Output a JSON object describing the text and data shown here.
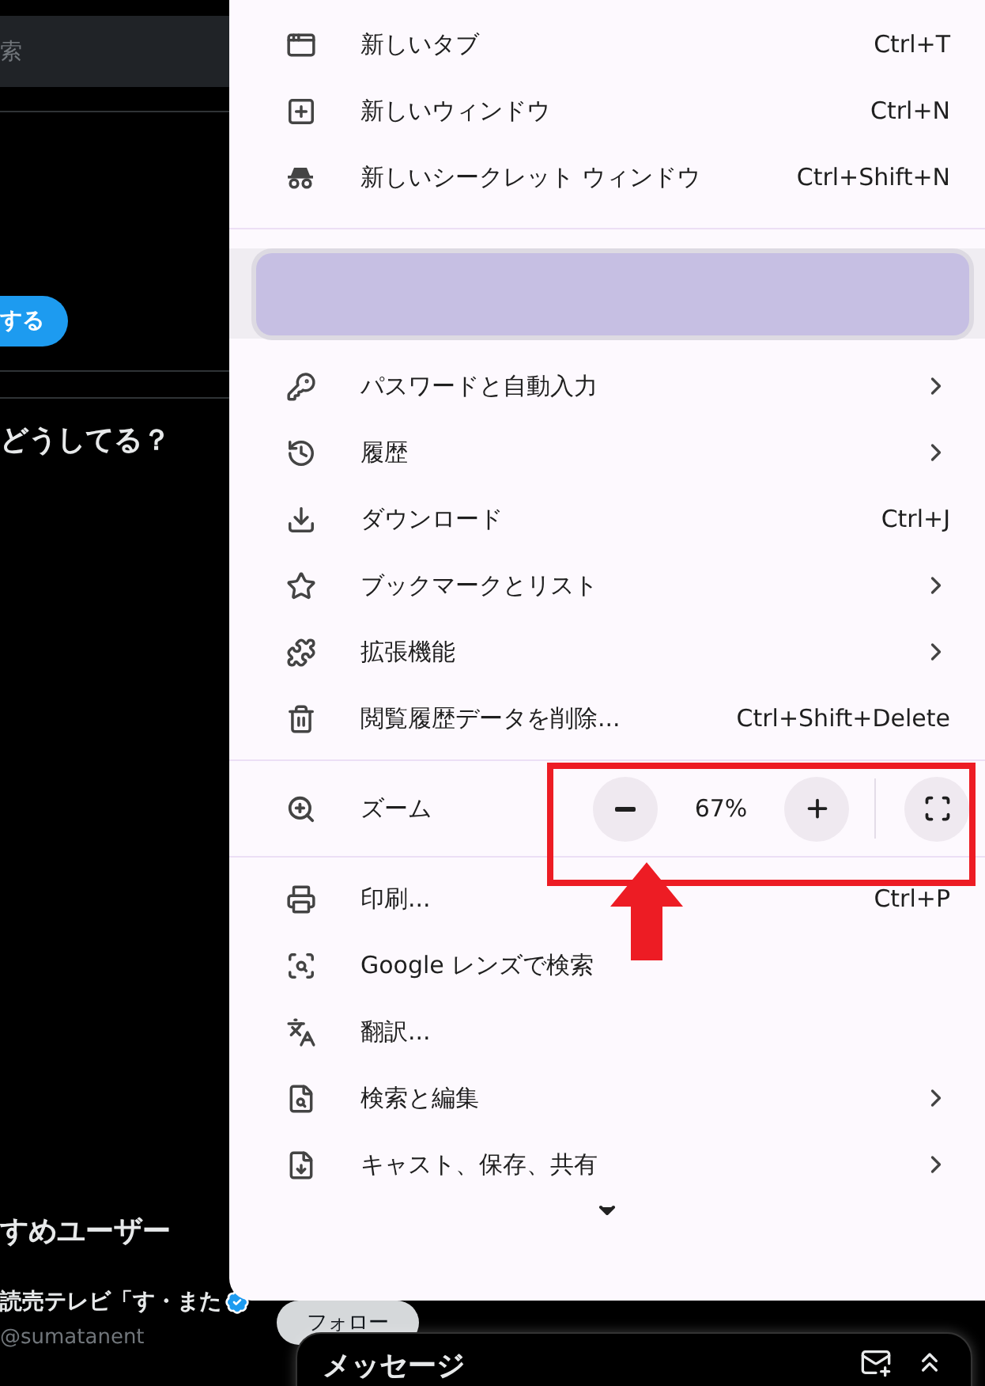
{
  "background": {
    "search_placeholder": "索",
    "action_button": "する",
    "heading": "どうしてる？",
    "suggestions_heading": "すめユーザー",
    "suggested_user": {
      "name": "読売テレビ「す・また",
      "verified": true,
      "handle": "@sumatanent",
      "follow_button": "フォロー"
    },
    "messages_panel": {
      "title": "メッセージ"
    }
  },
  "menu": {
    "sections": [
      {
        "kind": "items",
        "items": [
          {
            "label": "新しいタブ",
            "shortcut": "Ctrl+T",
            "submenu": false
          },
          {
            "label": "新しいウィンドウ",
            "shortcut": "Ctrl+N",
            "submenu": false
          },
          {
            "label": "新しいシークレット ウィンドウ",
            "shortcut": "Ctrl+Shift+N",
            "submenu": false
          }
        ]
      },
      {
        "kind": "profile"
      },
      {
        "kind": "items",
        "items": [
          {
            "label": "パスワードと自動入力",
            "submenu": true
          },
          {
            "label": "履歴",
            "submenu": true
          },
          {
            "label": "ダウンロード",
            "shortcut": "Ctrl+J",
            "submenu": false
          },
          {
            "label": "ブックマークとリスト",
            "submenu": true
          },
          {
            "label": "拡張機能",
            "submenu": true
          },
          {
            "label": "閲覧履歴データを削除...",
            "shortcut": "Ctrl+Shift+Delete",
            "submenu": false
          }
        ]
      },
      {
        "kind": "zoom",
        "label": "ズーム",
        "value": "67%"
      },
      {
        "kind": "items",
        "items": [
          {
            "label": "印刷...",
            "shortcut": "Ctrl+P",
            "submenu": false
          },
          {
            "label": "Google レンズで検索",
            "submenu": false
          },
          {
            "label": "翻訳...",
            "submenu": false
          },
          {
            "label": "検索と編集",
            "submenu": true
          },
          {
            "label": "キャスト、保存、共有",
            "submenu": true
          }
        ]
      }
    ]
  }
}
